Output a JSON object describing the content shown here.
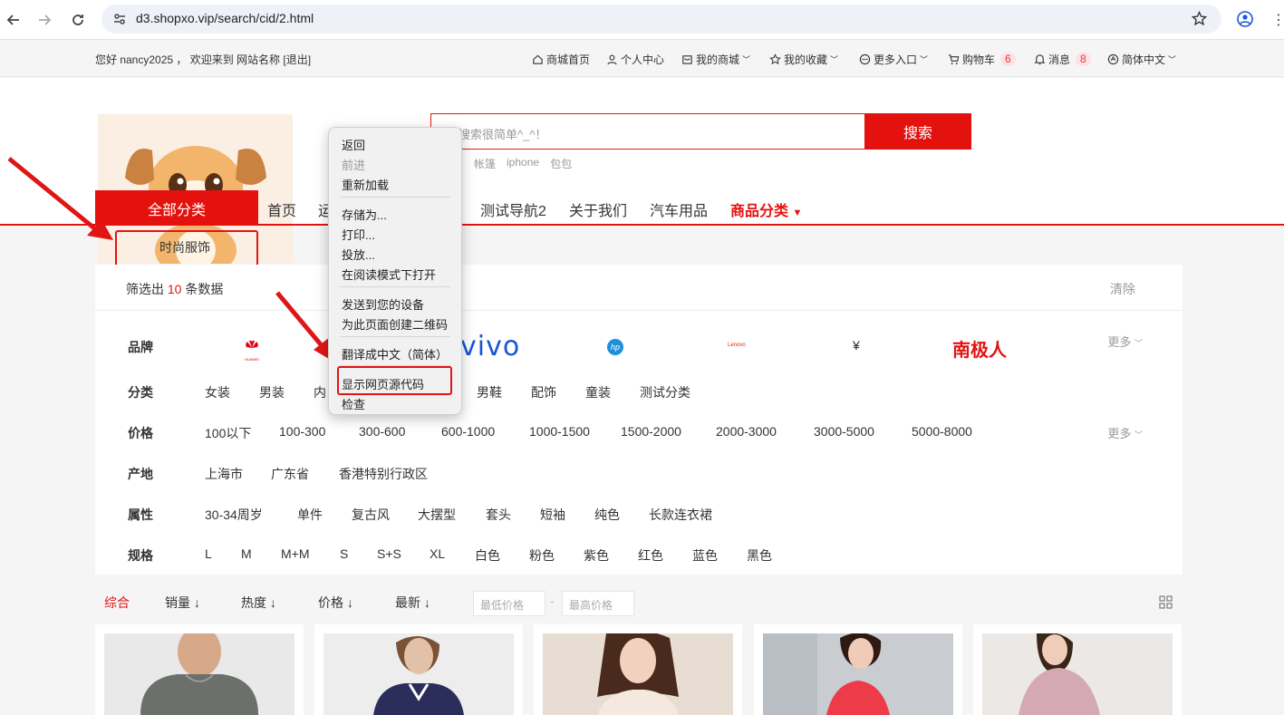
{
  "browser": {
    "url": "d3.shopxo.vip/search/cid/2.html"
  },
  "topbar": {
    "greeting": "您好 nancy2025 ， 欢迎来到 网站名称 [退出]",
    "links": [
      {
        "label": "商城首页"
      },
      {
        "label": "个人中心"
      },
      {
        "label": "我的商城"
      },
      {
        "label": "我的收藏"
      },
      {
        "label": "更多入口"
      },
      {
        "label": "购物车",
        "badge": "6"
      },
      {
        "label": "消息",
        "badge": "8"
      },
      {
        "label": "简体中文"
      }
    ]
  },
  "search": {
    "placeholder": "搜索很简单^_^！",
    "button": "搜索",
    "hotwords": [
      "帐篷",
      "iphone",
      "包包"
    ]
  },
  "nav": {
    "all_categories": "全部分类",
    "items": [
      "首页",
      "运",
      "测试导航2",
      "关于我们",
      "汽车用品",
      "商品分类"
    ],
    "category_panel_item": "时尚服饰"
  },
  "filter": {
    "summary_prefix": "筛选出",
    "count": "10",
    "summary_suffix": "条数据",
    "clear": "清除",
    "more": "更多",
    "brand_label": "品牌",
    "brands": [
      "HUAWEI",
      "vivo",
      "hp",
      "Lenovo",
      "南极人"
    ],
    "category_label": "分类",
    "categories": [
      "女装",
      "男装",
      "内",
      "男鞋",
      "配饰",
      "童装",
      "测试分类"
    ],
    "price_label": "价格",
    "prices": [
      "100以下",
      "100-300",
      "300-600",
      "600-1000",
      "1000-1500",
      "1500-2000",
      "2000-3000",
      "3000-5000",
      "5000-8000"
    ],
    "origin_label": "产地",
    "origins": [
      "上海市",
      "广东省",
      "香港特别行政区"
    ],
    "attr_label": "属性",
    "attrs": [
      "30-34周岁",
      "单件",
      "复古风",
      "大摆型",
      "套头",
      "短袖",
      "纯色",
      "长款连衣裙"
    ],
    "spec_label": "规格",
    "specs": [
      "L",
      "M",
      "M+M",
      "S",
      "S+S",
      "XL",
      "白色",
      "粉色",
      "紫色",
      "红色",
      "蓝色",
      "黑色"
    ]
  },
  "sort": {
    "items": [
      "综合",
      "销量",
      "热度",
      "价格",
      "最新"
    ],
    "min_price_placeholder": "最低价格",
    "max_price_placeholder": "最高价格",
    "dash": "-"
  },
  "context_menu": {
    "items": [
      "返回",
      "前进",
      "重新加载",
      "存储为...",
      "打印...",
      "投放...",
      "在阅读模式下打开",
      "发送到您的设备",
      "为此页面创建二维码",
      "翻译成中文（简体）",
      "显示网页源代码",
      "检查"
    ]
  },
  "colors": {
    "accent": "#e4120f",
    "annotation": "#e01515"
  }
}
